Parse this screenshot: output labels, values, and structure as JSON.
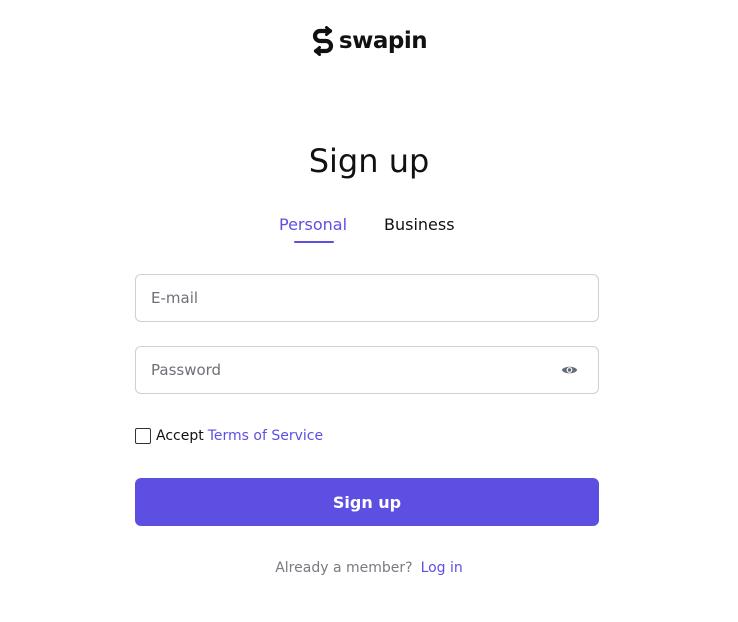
{
  "brand": {
    "name": "swapin",
    "logo_icon": "swap-s-icon",
    "text_color": "#111111"
  },
  "title": "Sign up",
  "tabs": [
    {
      "label": "Personal",
      "active": true
    },
    {
      "label": "Business",
      "active": false
    }
  ],
  "form": {
    "email": {
      "value": "",
      "placeholder": "E-mail"
    },
    "password": {
      "value": "",
      "placeholder": "Password",
      "toggle_icon": "eye-icon"
    },
    "terms": {
      "checked": false,
      "prefix": "Accept",
      "link_label": "Terms of Service"
    },
    "submit_label": "Sign up"
  },
  "footer": {
    "text": "Already a member?",
    "link_label": "Log in"
  },
  "colors": {
    "accent": "#5e4fe3",
    "border": "#cfcfd4",
    "muted_text": "#7a7a82",
    "placeholder": "#6f6f78"
  }
}
